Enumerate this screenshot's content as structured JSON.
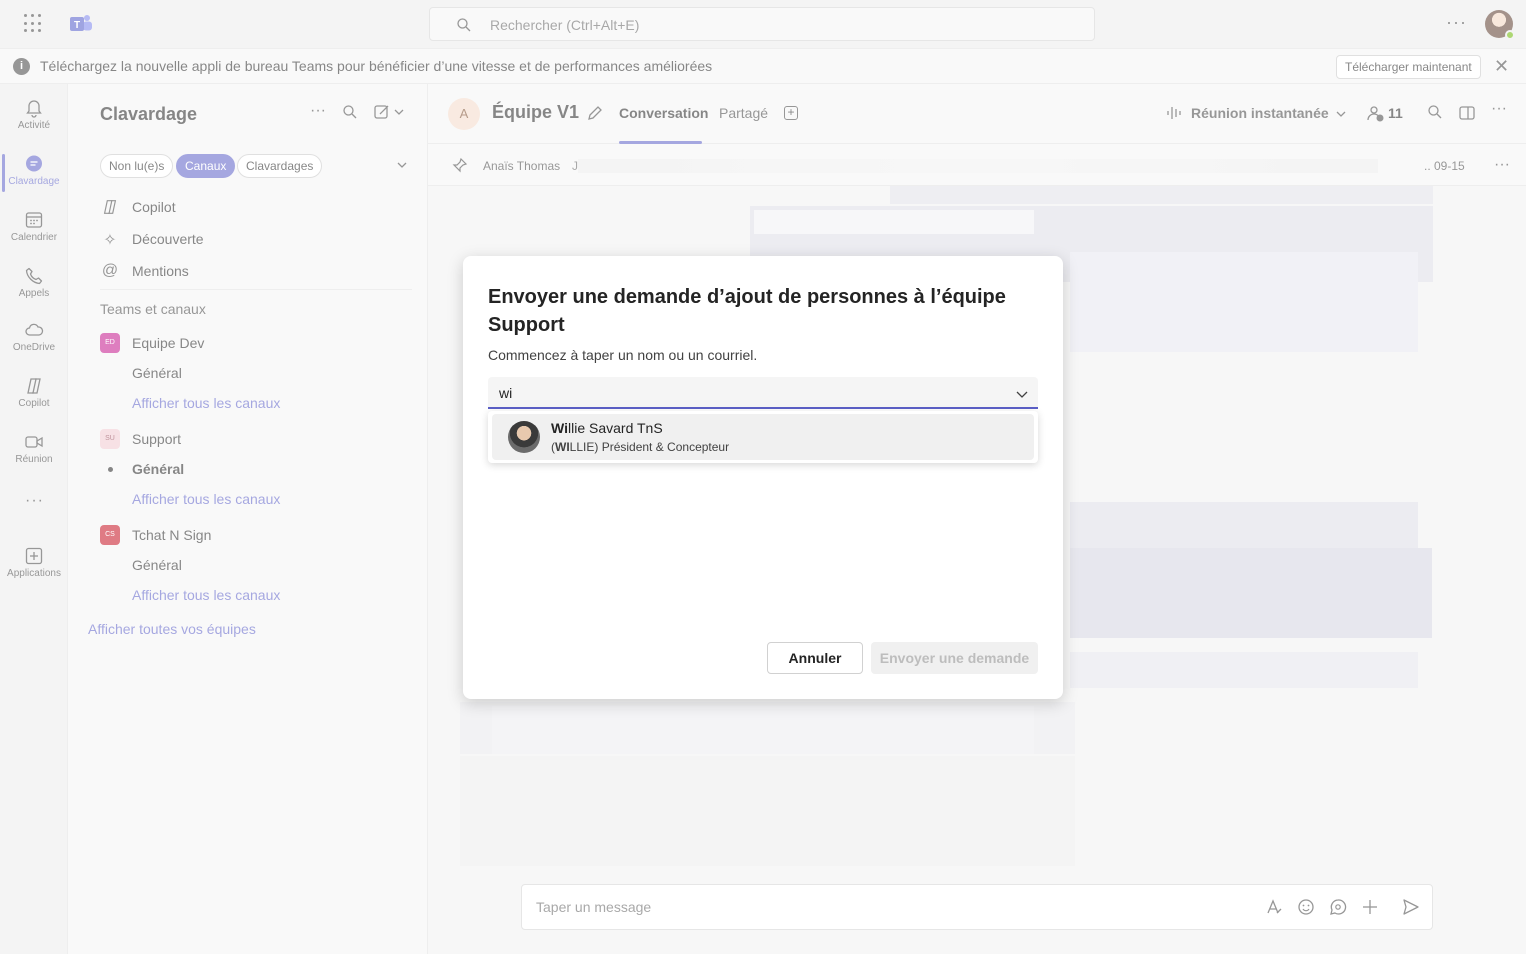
{
  "topbar": {
    "search_placeholder": "Rechercher (Ctrl+Alt+E)",
    "more": "···"
  },
  "banner": {
    "message": "Téléchargez la nouvelle appli de bureau Teams pour bénéficier d’une vitesse et de performances améliorées",
    "download_label": "Télécharger maintenant"
  },
  "rail": {
    "items": [
      {
        "label": "Activité",
        "icon": "bell-icon"
      },
      {
        "label": "Clavardage",
        "icon": "chat-icon"
      },
      {
        "label": "Calendrier",
        "icon": "calendar-icon"
      },
      {
        "label": "Appels",
        "icon": "phone-icon"
      },
      {
        "label": "OneDrive",
        "icon": "cloud-icon"
      },
      {
        "label": "Copilot",
        "icon": "copilot-icon"
      },
      {
        "label": "Réunion",
        "icon": "video-icon"
      },
      {
        "label": "Applications",
        "icon": "add-app-icon"
      }
    ],
    "more": "···"
  },
  "sidepanel": {
    "title": "Clavardage",
    "filters": [
      "Non lu(e)s",
      "Canaux",
      "Clavardages"
    ],
    "quick": [
      {
        "label": "Copilot",
        "icon": "copilot-icon"
      },
      {
        "label": "Découverte",
        "icon": "sparkle-icon"
      },
      {
        "label": "Mentions",
        "icon": "at-icon"
      }
    ],
    "section_title": "Teams et canaux",
    "teams": [
      {
        "badge": "ED",
        "name": "Equipe Dev",
        "channel": "Général",
        "link": "Afficher tous les canaux",
        "color": "#c4148b"
      },
      {
        "badge": "SU",
        "name": "Support",
        "channel": "Général",
        "link": "Afficher tous les canaux",
        "color": "#f0c8d0"
      },
      {
        "badge": "CS",
        "name": "Tchat N Sign",
        "channel": "Général",
        "link": "Afficher tous les canaux",
        "color": "#c50f1f"
      }
    ],
    "all_teams_link": "Afficher toutes vos équipes"
  },
  "chat": {
    "avatar_letter": "A",
    "channel_name": "Équipe V1",
    "tabs": [
      "Conversation",
      "Partagé"
    ],
    "meet_label": "Réunion instantanée",
    "people_count": "11",
    "pinned_author": "Anaïs Thomas",
    "pinned_initial": "J",
    "pinned_date": ".. 09-15",
    "composer_placeholder": "Taper un message"
  },
  "dialog": {
    "title": "Envoyer une demande d’ajout de personnes à l’équipe Support",
    "subtitle": "Commencez à taper un nom ou un courriel.",
    "input_value": "wi",
    "suggestion": {
      "name_bold": "Wi",
      "name_rest": "llie Savard TnS",
      "desc_prefix": "(",
      "desc_bold": "WI",
      "desc_rest": "LLIE) Président & Concepteur"
    },
    "cancel_label": "Annuler",
    "send_label": "Envoyer une demande"
  },
  "colors": {
    "accent": "#5b5fc7"
  }
}
